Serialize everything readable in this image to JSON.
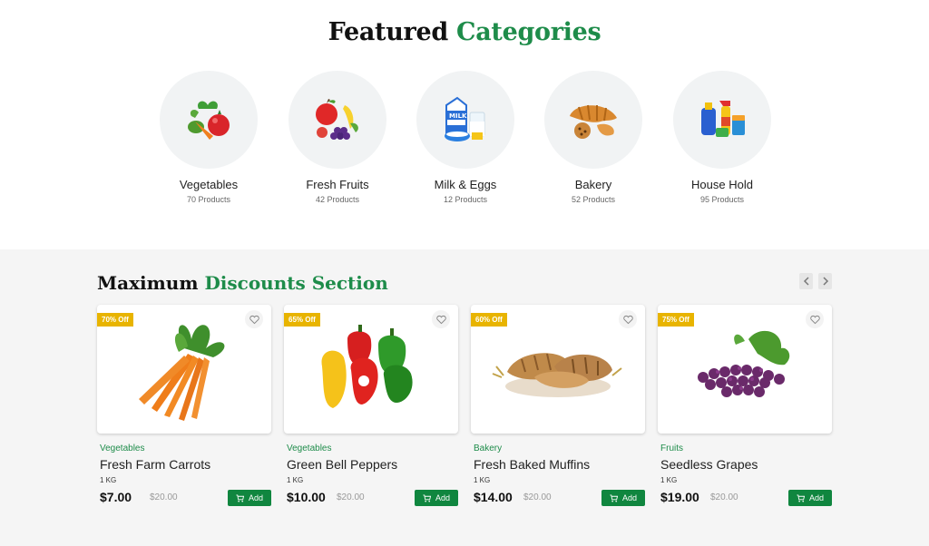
{
  "featured": {
    "title_part1": "Featured",
    "title_part2": "Categories",
    "categories": [
      {
        "name": "Vegetables",
        "count": "70 Products",
        "icon": "vegetables-icon"
      },
      {
        "name": "Fresh Fruits",
        "count": "42 Products",
        "icon": "fruits-icon"
      },
      {
        "name": "Milk & Eggs",
        "count": "12 Products",
        "icon": "milk-eggs-icon"
      },
      {
        "name": "Bakery",
        "count": "52 Products",
        "icon": "bakery-icon"
      },
      {
        "name": "House Hold",
        "count": "95 Products",
        "icon": "household-icon"
      }
    ]
  },
  "discounts": {
    "title_part1": "Maximum",
    "title_part2": "Discounts Section",
    "products": [
      {
        "badge": "70% Off",
        "category": "Vegetables",
        "name": "Fresh Farm Carrots",
        "unit": "1 KG",
        "price": "$7.00",
        "old_price": "$20.00",
        "add_label": "Add",
        "image": "carrots-image"
      },
      {
        "badge": "65% Off",
        "category": "Vegetables",
        "name": "Green Bell Peppers",
        "unit": "1 KG",
        "price": "$10.00",
        "old_price": "$20.00",
        "add_label": "Add",
        "image": "peppers-image"
      },
      {
        "badge": "60% Off",
        "category": "Bakery",
        "name": "Fresh Baked Muffins",
        "unit": "1 KG",
        "price": "$14.00",
        "old_price": "$20.00",
        "add_label": "Add",
        "image": "bread-image"
      },
      {
        "badge": "75% Off",
        "category": "Fruits",
        "name": "Seedless Grapes",
        "unit": "1 KG",
        "price": "$19.00",
        "old_price": "$20.00",
        "add_label": "Add",
        "image": "grapes-image"
      }
    ]
  },
  "colors": {
    "accent": "#1e8c4a",
    "badge": "#e8b400",
    "button": "#10863f"
  }
}
